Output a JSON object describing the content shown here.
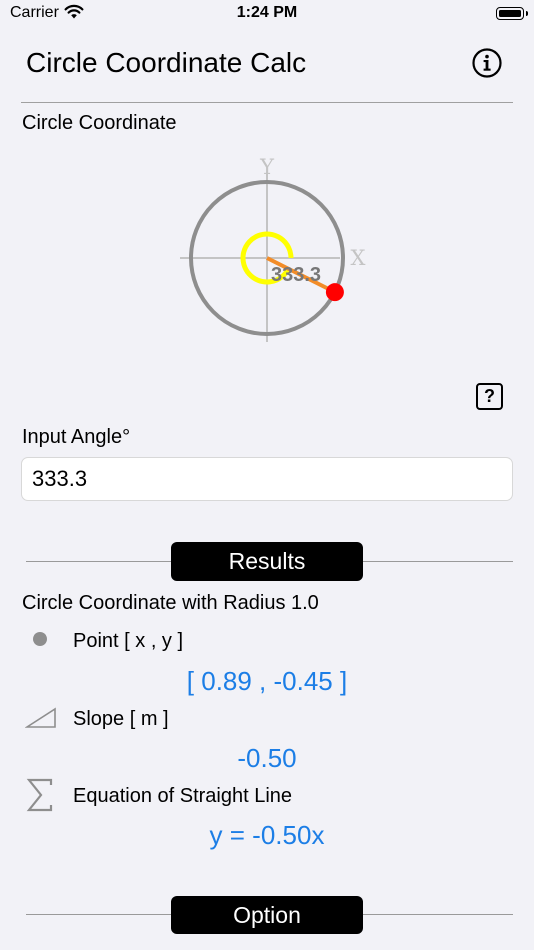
{
  "status_bar": {
    "carrier": "Carrier",
    "time": "1:24 PM"
  },
  "header": {
    "title": "Circle Coordinate Calc",
    "info_icon": "info-icon"
  },
  "diagram_section": {
    "label": "Circle Coordinate",
    "axis_x": "X",
    "axis_y": "Y",
    "angle_label": "333.3",
    "angle_deg": 333.3,
    "colors": {
      "circle": "#8e8e8e",
      "arc": "#ffff00",
      "radius_line": "#f28c28",
      "point": "#ff0000",
      "axes": "#c0c0c0"
    },
    "help_label": "?"
  },
  "input": {
    "label": "Input Angle°",
    "value": "333.3"
  },
  "results": {
    "header": "Results",
    "subtitle": "Circle Coordinate with Radius 1.0",
    "point": {
      "label": "Point [ x , y ]",
      "value": "[ 0.89 , -0.45 ]",
      "icon": "dot-icon"
    },
    "slope": {
      "label": "Slope [ m ]",
      "value": "-0.50",
      "icon": "slope-icon"
    },
    "equation": {
      "label": "Equation of Straight Line",
      "value": "y = -0.50x",
      "icon": "sigma-icon"
    }
  },
  "option": {
    "header": "Option"
  },
  "accent_color": "#1c7ee6"
}
